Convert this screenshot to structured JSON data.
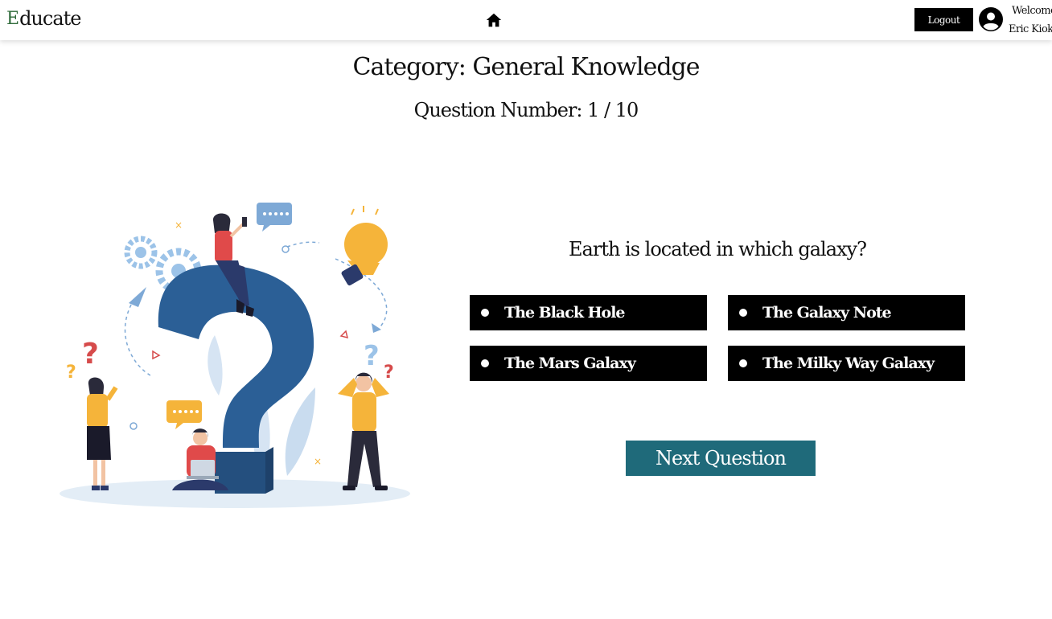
{
  "header": {
    "brand_mark": "E",
    "brand_text": "ducate",
    "logout_label": "Logout",
    "welcome_line1": "Welcome",
    "welcome_line2": "Eric Kioko"
  },
  "quiz": {
    "category": "Category: General Knowledge",
    "question_number": "Question Number: 1 / 10",
    "question": "Earth is located in which galaxy?",
    "options": [
      {
        "label": "The Black Hole"
      },
      {
        "label": "The Galaxy Note"
      },
      {
        "label": "The Mars Galaxy"
      },
      {
        "label": "The Milky Way Galaxy"
      }
    ],
    "next_label": "Next Question"
  },
  "icons": {
    "home": "home-icon",
    "avatar": "user-circle-icon"
  },
  "colors": {
    "option_bg": "#000000",
    "next_button_bg": "#1f6a7a",
    "question_mark": "#2b5f96",
    "accent_yellow": "#f5b43a"
  }
}
